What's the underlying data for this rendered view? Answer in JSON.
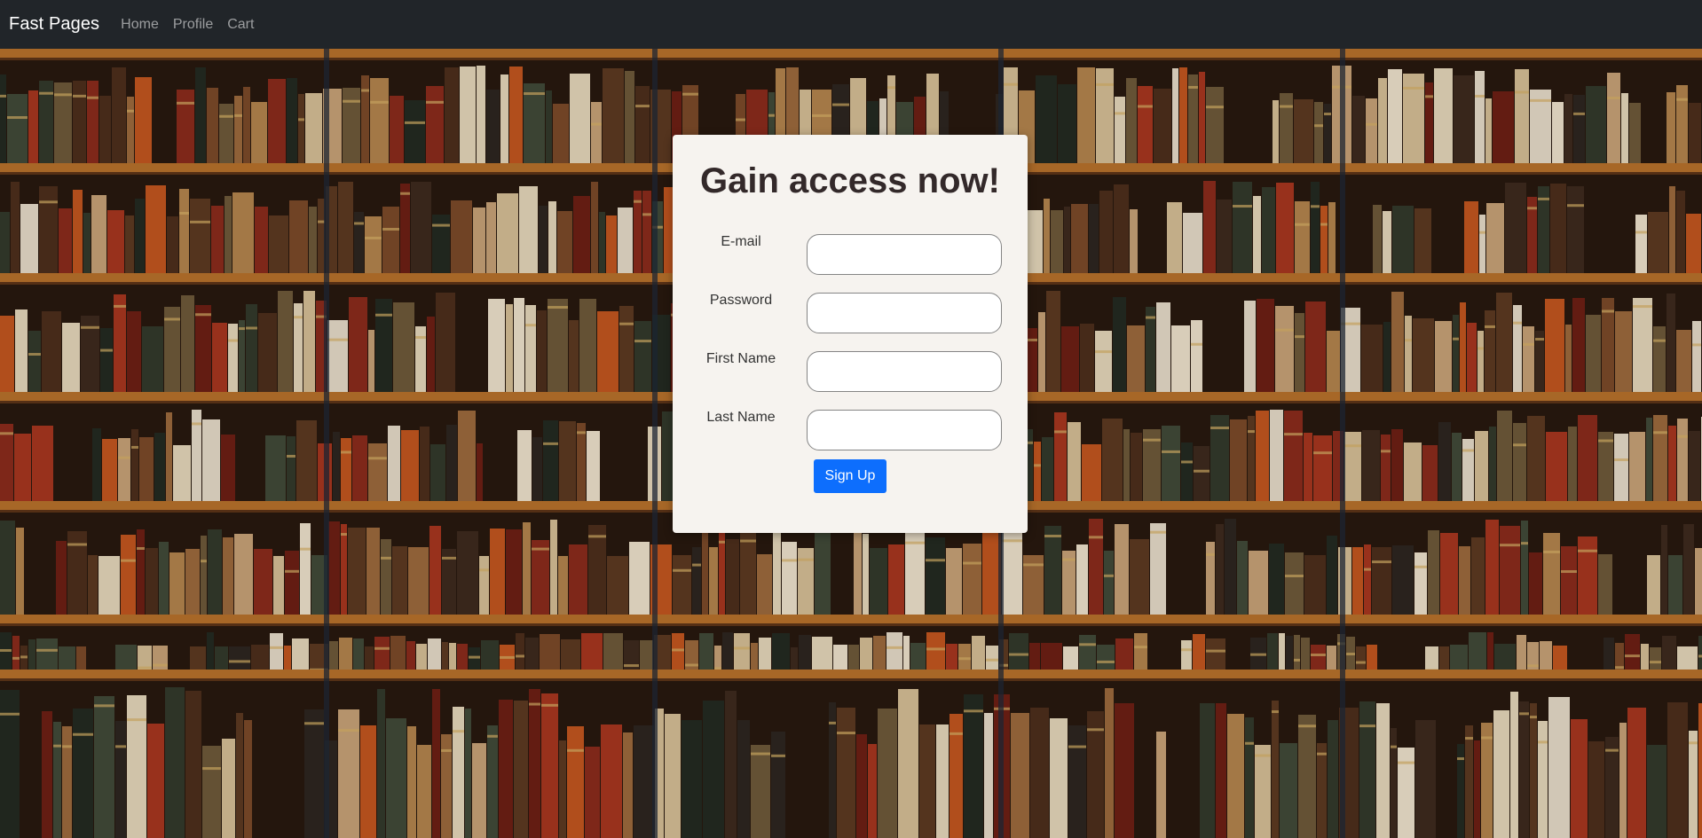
{
  "navbar": {
    "brand": "Fast Pages",
    "links": [
      "Home",
      "Profile",
      "Cart"
    ]
  },
  "signup": {
    "title": "Gain access now!",
    "fields": [
      {
        "label": "E-mail",
        "value": "",
        "placeholder": ""
      },
      {
        "label": "Password",
        "value": "",
        "placeholder": ""
      },
      {
        "label": "First Name",
        "value": "",
        "placeholder": ""
      },
      {
        "label": "Last Name",
        "value": "",
        "placeholder": ""
      }
    ],
    "submit_label": "Sign Up"
  },
  "colors": {
    "navbar_bg": "#212529",
    "card_bg": "#f6f3ef",
    "primary_button": "#0d6efd"
  }
}
